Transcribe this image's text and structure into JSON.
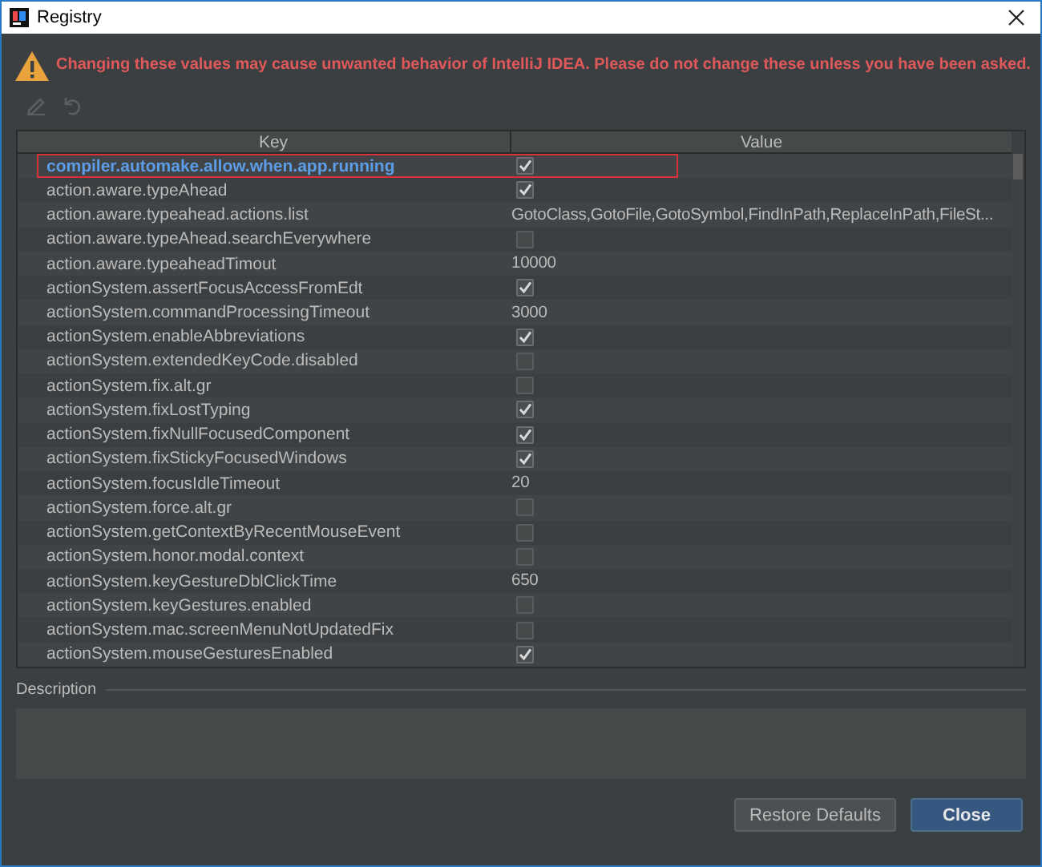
{
  "window": {
    "title": "Registry"
  },
  "warning": "Changing these values may cause unwanted behavior of IntelliJ IDEA. Please do not change these unless you have been asked.",
  "toolbar": [
    {
      "kind": "edit",
      "disabled": true
    },
    {
      "kind": "revert",
      "disabled": true
    }
  ],
  "table": {
    "columns": [
      "Key",
      "Value"
    ],
    "rows": [
      {
        "key": "compiler.automake.allow.when.app.running",
        "kind": "checkbox",
        "checked": true,
        "modified": true,
        "highlighted": true
      },
      {
        "key": "action.aware.typeAhead",
        "kind": "checkbox",
        "checked": true,
        "modified": false,
        "highlighted": false
      },
      {
        "key": "action.aware.typeahead.actions.list",
        "kind": "text",
        "value": "GotoClass,GotoFile,GotoSymbol,FindInPath,ReplaceInPath,FileSt...",
        "modified": false,
        "highlighted": false
      },
      {
        "key": "action.aware.typeAhead.searchEverywhere",
        "kind": "checkbox",
        "checked": false,
        "modified": false,
        "highlighted": false
      },
      {
        "key": "action.aware.typeaheadTimout",
        "kind": "text",
        "value": "10000",
        "modified": false,
        "highlighted": false
      },
      {
        "key": "actionSystem.assertFocusAccessFromEdt",
        "kind": "checkbox",
        "checked": true,
        "modified": false,
        "highlighted": false
      },
      {
        "key": "actionSystem.commandProcessingTimeout",
        "kind": "text",
        "value": "3000",
        "modified": false,
        "highlighted": false
      },
      {
        "key": "actionSystem.enableAbbreviations",
        "kind": "checkbox",
        "checked": true,
        "modified": false,
        "highlighted": false
      },
      {
        "key": "actionSystem.extendedKeyCode.disabled",
        "kind": "checkbox",
        "checked": false,
        "modified": false,
        "highlighted": false
      },
      {
        "key": "actionSystem.fix.alt.gr",
        "kind": "checkbox",
        "checked": false,
        "modified": false,
        "highlighted": false
      },
      {
        "key": "actionSystem.fixLostTyping",
        "kind": "checkbox",
        "checked": true,
        "modified": false,
        "highlighted": false
      },
      {
        "key": "actionSystem.fixNullFocusedComponent",
        "kind": "checkbox",
        "checked": true,
        "modified": false,
        "highlighted": false
      },
      {
        "key": "actionSystem.fixStickyFocusedWindows",
        "kind": "checkbox",
        "checked": true,
        "modified": false,
        "highlighted": false
      },
      {
        "key": "actionSystem.focusIdleTimeout",
        "kind": "text",
        "value": "20",
        "modified": false,
        "highlighted": false
      },
      {
        "key": "actionSystem.force.alt.gr",
        "kind": "checkbox",
        "checked": false,
        "modified": false,
        "highlighted": false
      },
      {
        "key": "actionSystem.getContextByRecentMouseEvent",
        "kind": "checkbox",
        "checked": false,
        "modified": false,
        "highlighted": false
      },
      {
        "key": "actionSystem.honor.modal.context",
        "kind": "checkbox",
        "checked": false,
        "modified": false,
        "highlighted": false
      },
      {
        "key": "actionSystem.keyGestureDblClickTime",
        "kind": "text",
        "value": "650",
        "modified": false,
        "highlighted": false
      },
      {
        "key": "actionSystem.keyGestures.enabled",
        "kind": "checkbox",
        "checked": false,
        "modified": false,
        "highlighted": false
      },
      {
        "key": "actionSystem.mac.screenMenuNotUpdatedFix",
        "kind": "checkbox",
        "checked": false,
        "modified": false,
        "highlighted": false
      },
      {
        "key": "actionSystem.mouseGesturesEnabled",
        "kind": "checkbox",
        "checked": true,
        "modified": false,
        "highlighted": false
      }
    ]
  },
  "description": {
    "label": "Description"
  },
  "buttons": [
    {
      "label": "Restore Defaults",
      "kind": "normal"
    },
    {
      "label": "Close",
      "kind": "default"
    }
  ]
}
